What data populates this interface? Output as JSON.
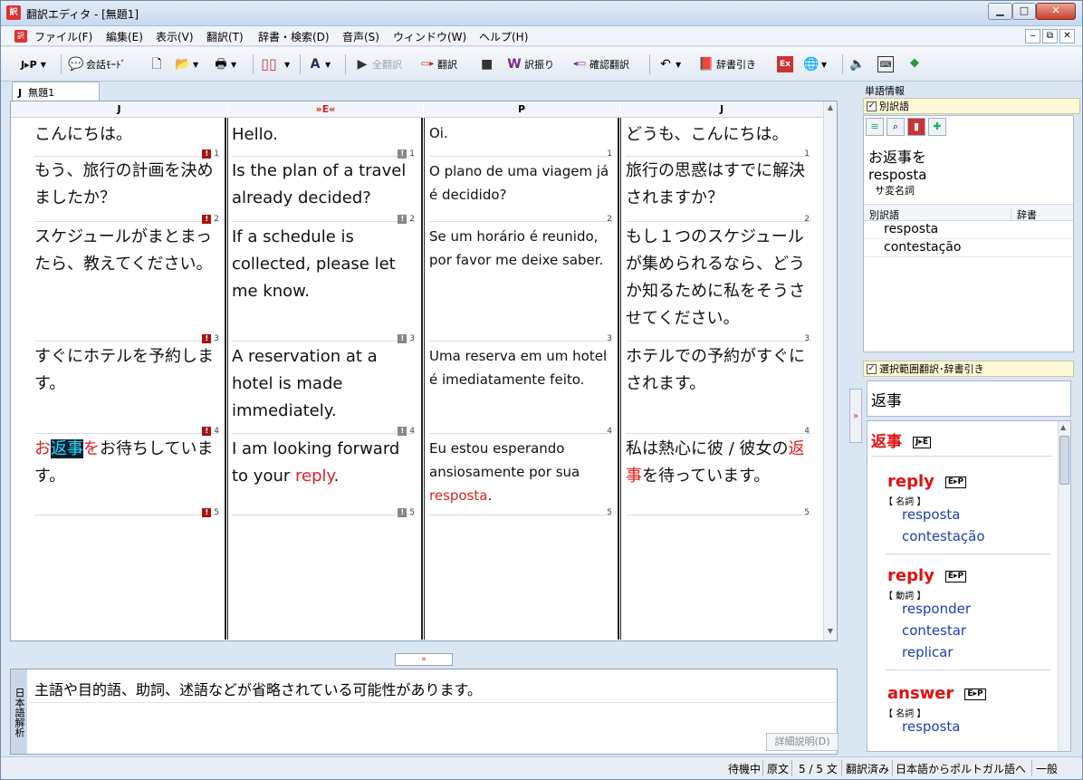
{
  "window": {
    "title": "翻訳エディタ - [無題1]",
    "app_icon": "訳",
    "controls": {
      "minimize": "▁",
      "maximize": "□",
      "close": "✕"
    }
  },
  "menu": {
    "items": [
      "ファイル(F)",
      "編集(E)",
      "表示(V)",
      "翻訳(T)",
      "辞書・検索(D)",
      "音声(S)",
      "ウィンドウ(W)",
      "ヘルプ(H)"
    ],
    "mdi": {
      "min": "‒",
      "restore": "⧉",
      "close": "✕"
    }
  },
  "toolbar": {
    "lang_pair": "J▸P",
    "conversation_mode": "会話ﾓｰﾄﾞ",
    "translate_all": "全翻訳",
    "translate": "翻訳",
    "stop": "■",
    "assign": "訳振り",
    "check_translate": "確認翻訳",
    "dictionary_lookup": "辞書引き"
  },
  "document_tab": {
    "prefix": "J",
    "label": "無題1"
  },
  "columns": {
    "j1": "J",
    "e": "»E«",
    "p": "P",
    "j2": "J"
  },
  "rows": [
    {
      "num": "",
      "j": "こんにちは。",
      "e": "Hello.",
      "p": "Oi.",
      "j2": "どうも、こんにちは。"
    },
    {
      "num": "1",
      "j": "もう、旅行の計画を決めましたか？",
      "e": "Is the plan of a travel already decided?",
      "p": "O plano de uma viagem já é decidido?",
      "j2": "旅行の思惑はすでに解決されますか？"
    },
    {
      "num": "2",
      "j": "スケジュールがまとまったら、教えてください。",
      "e": "If a schedule is collected, please let me know.",
      "p": "Se um horário é reunido, por favor me deixe saber.",
      "j2": "もし１つのスケジュールが集められるなら、どうか知るために私をそうさせてください。"
    },
    {
      "num": "3",
      "j": "すぐにホテルを予約します。",
      "e": "A reservation at a hotel is made immediately.",
      "p": "Uma reserva em um hotel é imediatamente feito.",
      "j2": "ホテルでの予約がすぐにされます。"
    },
    {
      "num": "4",
      "j_parts": {
        "a": "お",
        "b": "返事",
        "c": "を",
        "d": "お待ちしています。"
      },
      "e_parts": {
        "a": "I am looking forward to your ",
        "b": "reply",
        "c": "."
      },
      "p_parts": {
        "a": "Eu estou esperando ansiosamente por sua ",
        "b": "resposta",
        "c": "."
      },
      "j2_parts": {
        "a": "私は熱心に彼 / 彼女の",
        "b": "返事",
        "c": "を待っています。"
      }
    },
    {
      "num": "5"
    }
  ],
  "bottom_panel": {
    "label": "日本語解析",
    "message": "主語や目的語、助詞、述語などが省略されている可能性があります。",
    "detail_button": "詳細説明(D)"
  },
  "word_panel": {
    "title": "単語情報",
    "checkbox_label": "別訳語",
    "headword": "お返事を",
    "translation": "resposta",
    "pos": "サ変名詞",
    "table_headers": [
      "別訳語",
      "辞書"
    ],
    "alternatives": [
      "resposta",
      "contestação"
    ]
  },
  "selection_panel": {
    "checkbox_label": "選択範囲翻訳･辞書引き",
    "selected_text": "返事",
    "entries": {
      "head": "返事",
      "head_badge": "J▸E",
      "e1": "reply",
      "e1_badge": "E▸P",
      "e1_pos": "【 名詞 】",
      "e1_tr": [
        "resposta",
        "contestação"
      ],
      "e2": "reply",
      "e2_badge": "E▸P",
      "e2_pos": "【 動詞 】",
      "e2_tr": [
        "responder",
        "contestar",
        "replicar"
      ],
      "e3": "answer",
      "e3_badge": "E▸P",
      "e3_pos": "【 名詞 】",
      "e3_tr": [
        "resposta"
      ]
    }
  },
  "status": {
    "state": "待機中",
    "mode": "原文",
    "count": "5 / 5 文",
    "done": "翻訳済み",
    "direction": "日本語からポルトガル語へ",
    "field": "一般"
  }
}
